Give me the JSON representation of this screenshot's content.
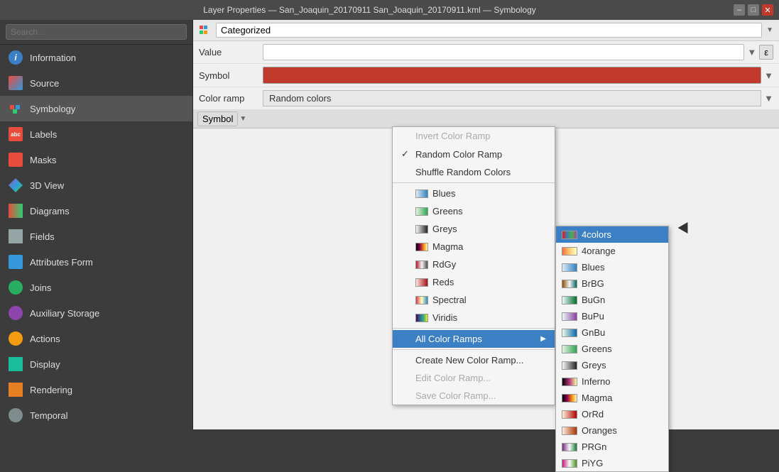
{
  "titlebar": {
    "title": "Layer Properties — San_Joaquin_20170911 San_Joaquin_20170911.kml — Symbology",
    "minimize": "–",
    "restore": "□",
    "close": "✕"
  },
  "sidebar": {
    "search_placeholder": "Search...",
    "items": [
      {
        "id": "information",
        "label": "Information",
        "icon": "info-icon"
      },
      {
        "id": "source",
        "label": "Source",
        "icon": "source-icon"
      },
      {
        "id": "symbology",
        "label": "Symbology",
        "icon": "symbology-icon",
        "active": true
      },
      {
        "id": "labels",
        "label": "Labels",
        "icon": "labels-icon"
      },
      {
        "id": "masks",
        "label": "Masks",
        "icon": "masks-icon"
      },
      {
        "id": "3dview",
        "label": "3D View",
        "icon": "3dview-icon"
      },
      {
        "id": "diagrams",
        "label": "Diagrams",
        "icon": "diagrams-icon"
      },
      {
        "id": "fields",
        "label": "Fields",
        "icon": "fields-icon"
      },
      {
        "id": "attributesform",
        "label": "Attributes Form",
        "icon": "attrform-icon"
      },
      {
        "id": "joins",
        "label": "Joins",
        "icon": "joins-icon"
      },
      {
        "id": "auxiliarystorage",
        "label": "Auxiliary Storage",
        "icon": "auxstorage-icon"
      },
      {
        "id": "actions",
        "label": "Actions",
        "icon": "actions-icon"
      },
      {
        "id": "display",
        "label": "Display",
        "icon": "display-icon"
      },
      {
        "id": "rendering",
        "label": "Rendering",
        "icon": "rendering-icon"
      },
      {
        "id": "temporal",
        "label": "Temporal",
        "icon": "temporal-icon"
      }
    ]
  },
  "content": {
    "renderer": "Categorized",
    "value_label": "Value",
    "symbol_label": "Symbol",
    "colorramp_label": "Color ramp",
    "colorramp_value": "Random colors"
  },
  "context_menu": {
    "items": [
      {
        "label": "Invert Color Ramp",
        "disabled": true,
        "checked": false
      },
      {
        "label": "Random Color Ramp",
        "checked": true,
        "disabled": false
      },
      {
        "label": "Shuffle Random Colors",
        "checked": false,
        "disabled": false
      },
      {
        "separator": true
      },
      {
        "label": "Blues",
        "swatch": "blues"
      },
      {
        "label": "Greens",
        "swatch": "greens"
      },
      {
        "label": "Greys",
        "swatch": "greys"
      },
      {
        "label": "Magma",
        "swatch": "magma"
      },
      {
        "label": "RdGy",
        "swatch": "rdgy"
      },
      {
        "label": "Reds",
        "swatch": "reds"
      },
      {
        "label": "Spectral",
        "swatch": "spectral"
      },
      {
        "label": "Viridis",
        "swatch": "viridis"
      },
      {
        "separator": true
      },
      {
        "label": "All Color Ramps",
        "submenu": true,
        "highlighted": true
      },
      {
        "separator": true
      },
      {
        "label": "Create New Color Ramp...",
        "disabled": false
      },
      {
        "label": "Edit Color Ramp...",
        "disabled": true
      },
      {
        "label": "Save Color Ramp...",
        "disabled": true
      }
    ]
  },
  "submenu": {
    "items": [
      {
        "label": "4colors",
        "swatch": "4colors",
        "highlighted": true
      },
      {
        "label": "4orange",
        "swatch": "4orange"
      },
      {
        "label": "Blues",
        "swatch": "blues"
      },
      {
        "label": "BrBG",
        "swatch": "brbg"
      },
      {
        "label": "BuGn",
        "swatch": "bugn"
      },
      {
        "label": "BuPu",
        "swatch": "bupu"
      },
      {
        "label": "GnBu",
        "swatch": "gnbu"
      },
      {
        "label": "Greens",
        "swatch": "greens"
      },
      {
        "label": "Greys",
        "swatch": "greys"
      },
      {
        "label": "Inferno",
        "swatch": "inferno"
      },
      {
        "label": "Magma",
        "swatch": "magma"
      },
      {
        "label": "OrRd",
        "swatch": "orrd"
      },
      {
        "label": "Oranges",
        "swatch": "oranges"
      },
      {
        "label": "PRGn",
        "swatch": "prgn"
      },
      {
        "label": "PiYG",
        "swatch": "piyg"
      }
    ]
  }
}
